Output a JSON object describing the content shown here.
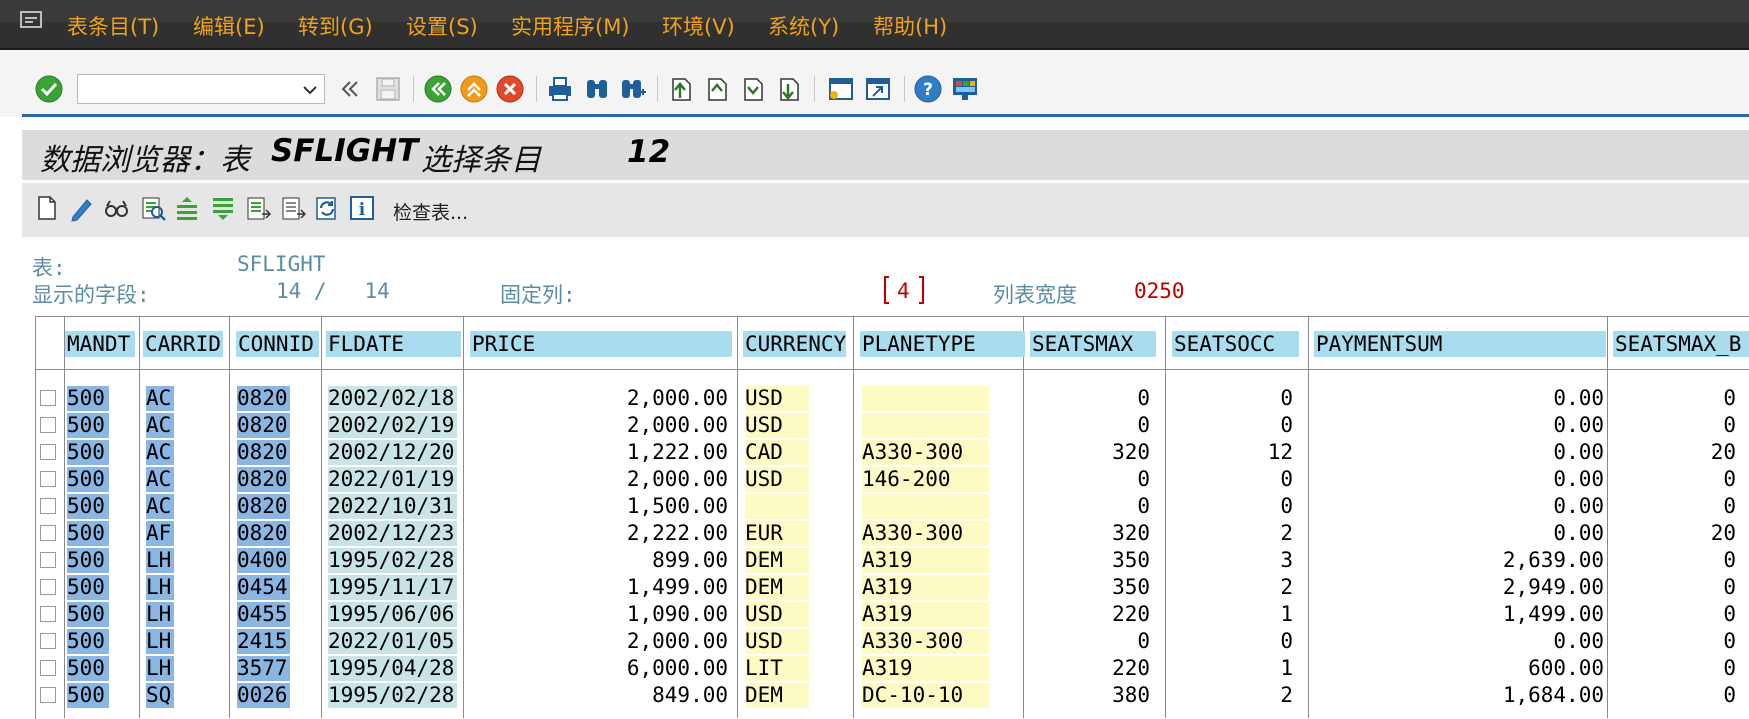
{
  "menu": {
    "items": [
      "表条目(T)",
      "编辑(E)",
      "转到(G)",
      "设置(S)",
      "实用程序(M)",
      "环境(V)",
      "系统(Y)",
      "帮助(H)"
    ]
  },
  "toolbar": {
    "command_field_value": "",
    "icons": [
      "enter-icon",
      "command-dropdown-icon",
      "collapse-icon",
      "save-icon",
      "back-icon",
      "exit-icon",
      "cancel-icon",
      "print-icon",
      "find-icon",
      "find-next-icon",
      "first-page-icon",
      "previous-page-icon",
      "next-page-icon",
      "last-page-icon",
      "new-session-icon",
      "shortcut-icon",
      "help-icon",
      "customize-layout-icon"
    ]
  },
  "title": {
    "prefix": "数据浏览器：表",
    "table": "SFLIGHT",
    "suffix": "选择条目",
    "count": "12"
  },
  "app_toolbar": {
    "icons": [
      "create-icon",
      "change-icon",
      "display-icon",
      "compare-icon",
      "sort-ascending-icon",
      "sort-descending-icon",
      "column-left-icon",
      "column-right-icon",
      "refresh-icon",
      "info-icon"
    ],
    "check_table_label": "检查表..."
  },
  "info": {
    "table_label": "表:",
    "table_value": "SFLIGHT",
    "fields_label": "显示的字段:",
    "fields_value": "14 /   14",
    "fixed_label": "固定列:",
    "fixed_value": "4",
    "width_label": "列表宽度",
    "width_value": "0250"
  },
  "colors": {
    "menu_text": "#f0a218",
    "key_cell": "#8ab6e3",
    "date_cell": "#c9e4e4",
    "yellow_cell": "#fdfbc4",
    "header_cell": "#a8dcee",
    "info_text": "#5a8ca6"
  },
  "table": {
    "columns": [
      "MANDT",
      "CARRID",
      "CONNID",
      "FLDATE",
      "PRICE",
      "CURRENCY",
      "PLANETYPE",
      "SEATSMAX",
      "SEATSOCC",
      "PAYMENTSUM",
      "SEATSMAX_B"
    ],
    "rows": [
      [
        "500",
        "AC",
        "0820",
        "2002/02/18",
        "2,000.00",
        "USD",
        "",
        "0",
        "0",
        "0.00",
        "0"
      ],
      [
        "500",
        "AC",
        "0820",
        "2002/02/19",
        "2,000.00",
        "USD",
        "",
        "0",
        "0",
        "0.00",
        "0"
      ],
      [
        "500",
        "AC",
        "0820",
        "2002/12/20",
        "1,222.00",
        "CAD",
        "A330-300",
        "320",
        "12",
        "0.00",
        "20"
      ],
      [
        "500",
        "AC",
        "0820",
        "2022/01/19",
        "2,000.00",
        "USD",
        "146-200",
        "0",
        "0",
        "0.00",
        "0"
      ],
      [
        "500",
        "AC",
        "0820",
        "2022/10/31",
        "1,500.00",
        "",
        "",
        "0",
        "0",
        "0.00",
        "0"
      ],
      [
        "500",
        "AF",
        "0820",
        "2002/12/23",
        "2,222.00",
        "EUR",
        "A330-300",
        "320",
        "2",
        "0.00",
        "20"
      ],
      [
        "500",
        "LH",
        "0400",
        "1995/02/28",
        "899.00",
        "DEM",
        "A319",
        "350",
        "3",
        "2,639.00",
        "0"
      ],
      [
        "500",
        "LH",
        "0454",
        "1995/11/17",
        "1,499.00",
        "DEM",
        "A319",
        "350",
        "2",
        "2,949.00",
        "0"
      ],
      [
        "500",
        "LH",
        "0455",
        "1995/06/06",
        "1,090.00",
        "USD",
        "A319",
        "220",
        "1",
        "1,499.00",
        "0"
      ],
      [
        "500",
        "LH",
        "2415",
        "2022/01/05",
        "2,000.00",
        "USD",
        "A330-300",
        "0",
        "0",
        "0.00",
        "0"
      ],
      [
        "500",
        "LH",
        "3577",
        "1995/04/28",
        "6,000.00",
        "LIT",
        "A319",
        "220",
        "1",
        "600.00",
        "0"
      ],
      [
        "500",
        "SQ",
        "0026",
        "1995/02/28",
        "849.00",
        "DEM",
        "DC-10-10",
        "380",
        "2",
        "1,684.00",
        "0"
      ]
    ]
  }
}
